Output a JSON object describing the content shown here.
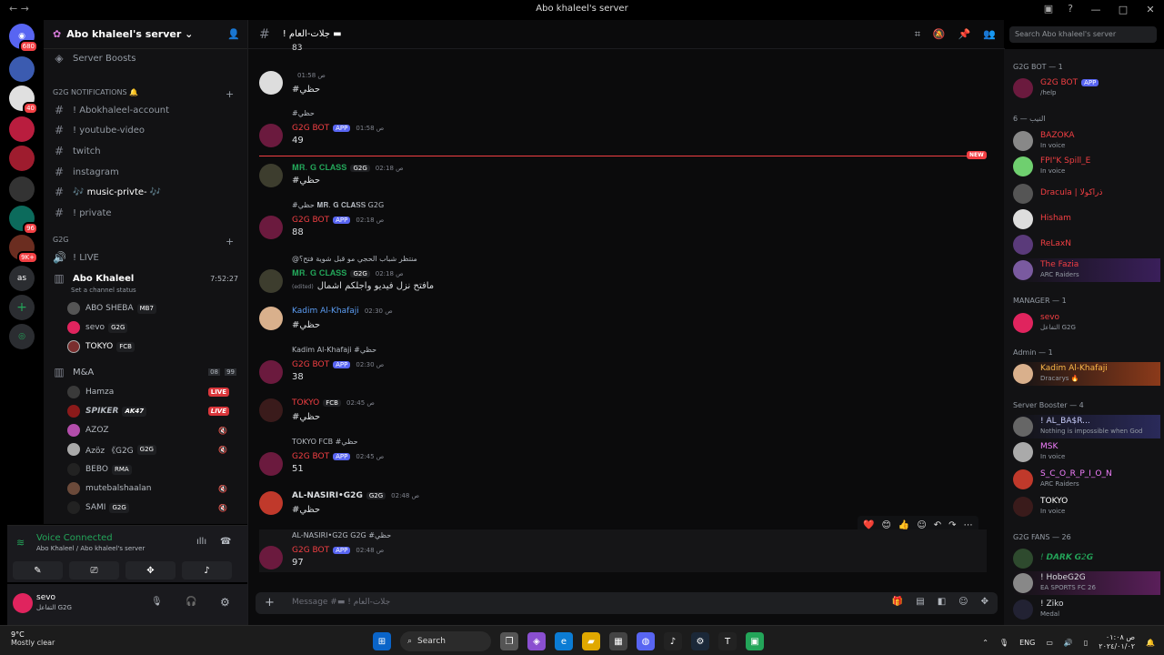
{
  "window": {
    "title": "Abo khaleel's server",
    "nav": "←   →"
  },
  "server": {
    "name": "Abo khaleel's server ⌄",
    "boosts": "Server Boosts"
  },
  "guild_badges": [
    "680",
    "40",
    "96",
    "9K+"
  ],
  "guild_labels": {
    "as": "as"
  },
  "channels": {
    "notif_category": "G2G NOTIFICATIONS 🔔",
    "items": [
      "! Abokhaleel-account",
      "! youtube-video",
      "twitch",
      "instagram",
      "🎶 music-privte- 🎶",
      "! private"
    ],
    "g2g_category": "G2G",
    "live": "! LIVE",
    "voice1": {
      "name": "Abo Khaleel",
      "time": "7:52:27",
      "status": "Set a channel status"
    },
    "voice1_users": [
      {
        "name": "ABO SHEBA",
        "tag": "MB7"
      },
      {
        "name": "sevo",
        "tag": "G2G"
      },
      {
        "name": "TOKYO",
        "tag": "FCB"
      }
    ],
    "voice2": {
      "name": "M&A",
      "c1": "08",
      "c2": "99"
    },
    "voice2_users": [
      {
        "name": "Hamza",
        "live": "LIVE"
      },
      {
        "name": "SPIKER",
        "tag": "AK47",
        "live": "LIVE"
      },
      {
        "name": "AZOZ"
      },
      {
        "name": "Azöz 《G2G",
        "tag": "G2G"
      },
      {
        "name": "BEBO",
        "tag": "RMA"
      },
      {
        "name": "mutebalshaalan"
      },
      {
        "name": "SAMI",
        "tag": "G2G"
      }
    ]
  },
  "voice": {
    "status": "Voice Connected",
    "sub": "Abo Khaleel / Abo khaleel's server"
  },
  "user": {
    "name": "sevo",
    "status": "التفاعل G2G"
  },
  "chat": {
    "channel": "! جلات-العام ▬",
    "top_number": "83",
    "messages": [
      {
        "user": "",
        "time": "01:58 ص",
        "body": "#حظي"
      },
      {
        "reply": "#حظي",
        "user": "G2G BOT",
        "app": "APP",
        "time": "01:58 ص",
        "body": "49"
      },
      {
        "user": "𝐌𝐑. 𝐆 𝐂𝐋𝐀𝐒𝐒",
        "tag": "G2G",
        "time": "02:18 ص",
        "body": "#حظي"
      },
      {
        "reply": "#حظي 𝐌𝐑. 𝐆 𝐂𝐋𝐀𝐒𝐒 G2G",
        "user": "G2G BOT",
        "app": "APP",
        "time": "02:18 ص",
        "body": "88"
      },
      {
        "reply": "@منتظر شباب الحجي مو قبل شوية فتح؟",
        "user": "𝐌𝐑. 𝐆 𝐂𝐋𝐀𝐒𝐒",
        "tag": "G2G",
        "time": "02:18 ص",
        "body": "مافتح نزل فيديو واجلكم اشمال",
        "edited": "(edited)"
      },
      {
        "user": "Kadim Al-Khafaji",
        "time": "02:30 ص",
        "body": "#حظي"
      },
      {
        "reply": "Kadim Al-Khafaji #حظي",
        "user": "G2G BOT",
        "app": "APP",
        "time": "02:30 ص",
        "body": "38"
      },
      {
        "user": "TOKYO",
        "tag": "FCB",
        "time": "02:45 ص",
        "body": "#حظي"
      },
      {
        "reply": "TOKYO FCB #حظي",
        "user": "G2G BOT",
        "app": "APP",
        "time": "02:45 ص",
        "body": "51"
      },
      {
        "user": "AL-NASIRI•G2G",
        "tag": "G2G",
        "time": "02:48 ص",
        "body": "#حظي"
      },
      {
        "reply": "AL-NASIRI•G2G G2G #حظي",
        "user": "G2G BOT",
        "app": "APP",
        "time": "02:48 ص",
        "body": "97"
      }
    ],
    "new_label": "NEW",
    "composer_placeholder": "Message #▬ ! جلات-العام"
  },
  "search": {
    "placeholder": "Search Abo khaleel's server"
  },
  "members": {
    "cats": [
      "G2G BOT — 1",
      "النيب — 6",
      "MANAGER — 1",
      "Admin — 1",
      "Server Booster — 4",
      "G2G FANS — 26"
    ],
    "list": [
      {
        "name": "G2G BOT",
        "sub": "/help",
        "app": "APP",
        "color": "#f23f43"
      },
      {
        "name": "BAZOKA",
        "sub": "In voice",
        "color": "#f23f43"
      },
      {
        "name": "FPI\"K Spill_E",
        "sub": "In voice",
        "color": "#f23f43"
      },
      {
        "name": "Dracula | ذراكولا",
        "sub": "",
        "color": "#f23f43"
      },
      {
        "name": "Hisham",
        "sub": "",
        "color": "#f23f43"
      },
      {
        "name": "ReLaxN",
        "sub": "",
        "color": "#f23f43"
      },
      {
        "name": "The Fazia",
        "sub": "ARC Raiders",
        "color": "#f23f43"
      },
      {
        "name": "sevo",
        "sub": "التفاعل G2G",
        "color": "#f23f43"
      },
      {
        "name": "Kadim Al-Khafaji",
        "sub": "Dracarys 🔥",
        "color": "#fbb848"
      },
      {
        "name": "! AL_BA$R...",
        "sub": "Nothing is impossible when God",
        "color": "#c9cdfb"
      },
      {
        "name": "MSK",
        "sub": "In voice",
        "color": "#f47fff"
      },
      {
        "name": "S_C_O_R_P_I_O_N",
        "sub": "ARC Raiders",
        "color": "#f47fff"
      },
      {
        "name": "TOKYO",
        "sub": "In voice",
        "color": "#fff"
      },
      {
        "name": "! 𝘿𝘼𝙍𝙆 𝙂2𝙂",
        "sub": "",
        "color": "#23a559"
      },
      {
        "name": "! HobeG2G",
        "sub": "EA SPORTS FC 26",
        "color": "#dbdee1"
      },
      {
        "name": "! Ziko",
        "sub": "Medal",
        "color": "#dbdee1"
      }
    ]
  },
  "reactions": [
    "❤️",
    "😊",
    "👍",
    "☺",
    "↶",
    "↷",
    "⋯"
  ],
  "taskbar": {
    "temp": "9°C",
    "weather": "Mostly clear",
    "search": "Search",
    "lang": "ENG",
    "time": "ص ٠١:٠٨",
    "date": "٢٠٢٤/٠١/٠٢"
  }
}
